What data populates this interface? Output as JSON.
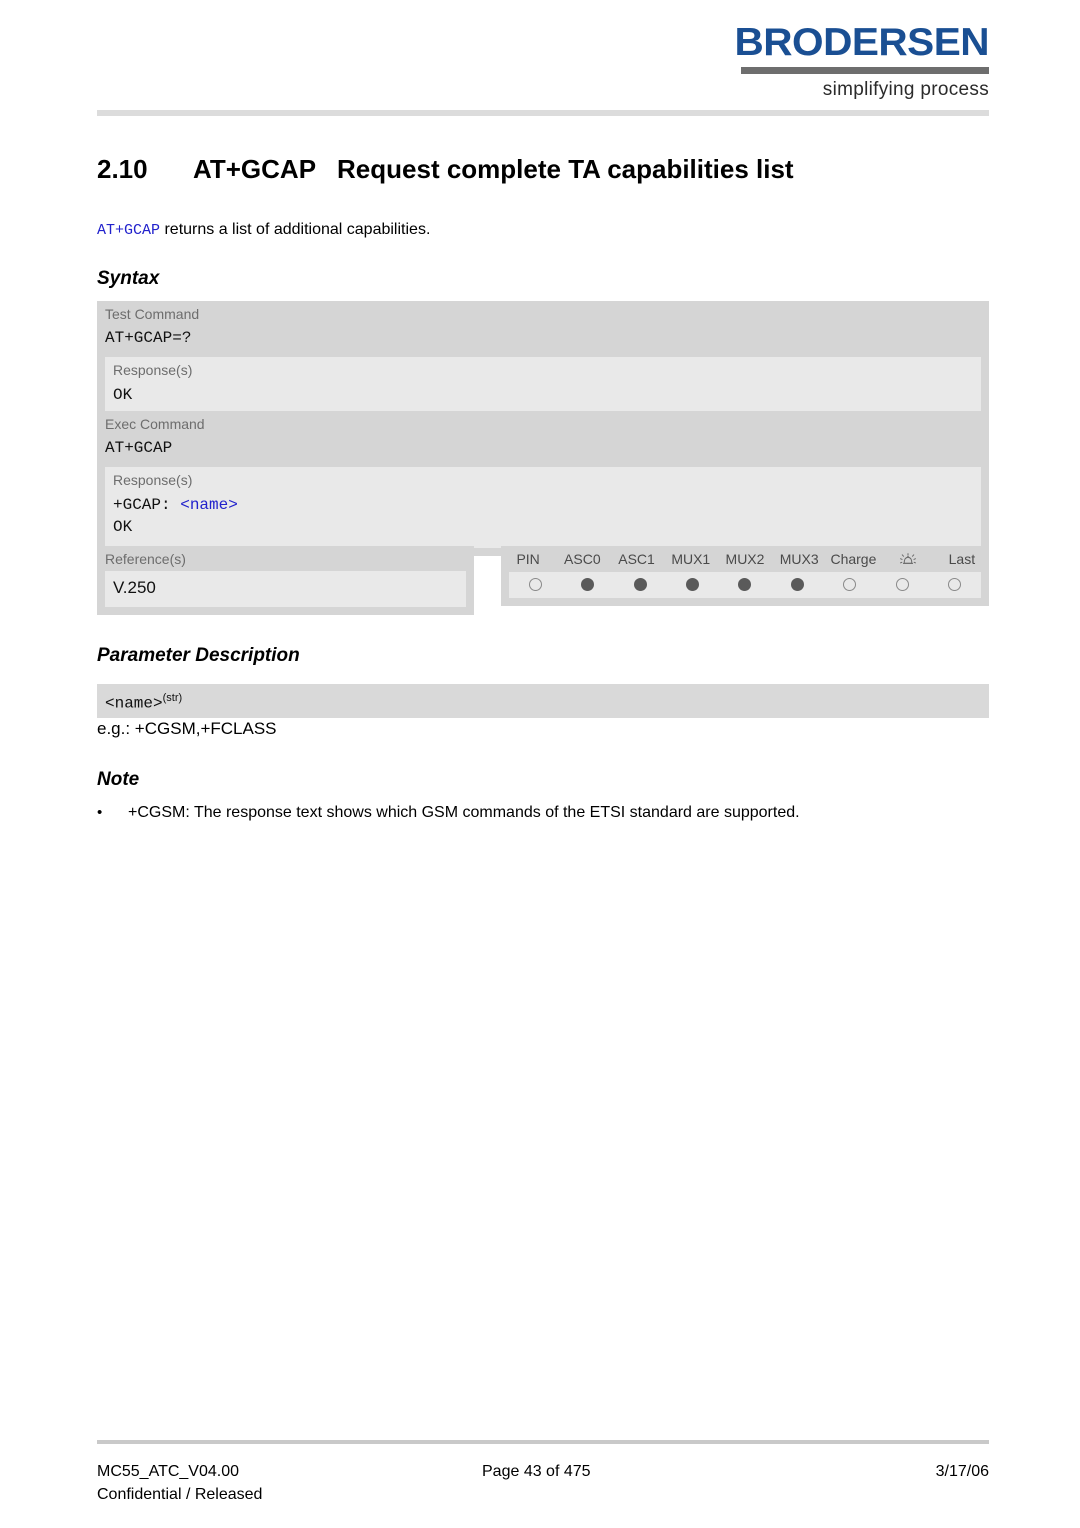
{
  "header": {
    "logo_word": "BRODERSEN",
    "logo_tagline": "simplifying process"
  },
  "title": {
    "number": "2.10",
    "command": "AT+GCAP",
    "text": "Request complete TA capabilities list"
  },
  "intro": {
    "command": "AT+GCAP",
    "text": " returns a list of additional capabilities."
  },
  "sections": {
    "syntax": "Syntax",
    "parameter_description": "Parameter Description",
    "note": "Note"
  },
  "syntax": {
    "test": {
      "command_label": "Test Command",
      "command_value": "AT+GCAP=?",
      "response_label": "Response(s)",
      "response_value": "OK"
    },
    "exec": {
      "command_label": "Exec Command",
      "command_value": "AT+GCAP",
      "response_label": "Response(s)",
      "response_prefix": "+GCAP: ",
      "response_param": "<name>",
      "response_ok": "OK"
    }
  },
  "reference": {
    "label": "Reference(s)",
    "value": "V.250"
  },
  "capabilities": {
    "columns": [
      {
        "label": "PIN",
        "state": "empty"
      },
      {
        "label": "ASC0",
        "state": "filled"
      },
      {
        "label": "ASC1",
        "state": "filled"
      },
      {
        "label": "MUX1",
        "state": "filled"
      },
      {
        "label": "MUX2",
        "state": "filled"
      },
      {
        "label": "MUX3",
        "state": "filled"
      },
      {
        "label": "Charge",
        "state": "empty"
      },
      {
        "label": "",
        "icon": "alarm-bell-icon",
        "state": "empty"
      },
      {
        "label": "Last",
        "state": "empty"
      }
    ]
  },
  "parameter": {
    "name": "<name>",
    "type_superscript": "(str)",
    "example": "e.g.: +CGSM,+FCLASS"
  },
  "notes": [
    {
      "bullet": "•",
      "text": "+CGSM: The response text shows which GSM commands of the ETSI standard are supported."
    }
  ],
  "footer": {
    "document_id": "MC55_ATC_V04.00",
    "page": "Page 43 of 475",
    "date": "3/17/06",
    "classification": "Confidential / Released"
  },
  "colors": {
    "brand_blue": "#1a4f93",
    "code_blue": "#2222cc",
    "table_dark": "#d5d5d5",
    "table_light": "#e9e9e9",
    "dot_filled": "#5a5a5a"
  }
}
